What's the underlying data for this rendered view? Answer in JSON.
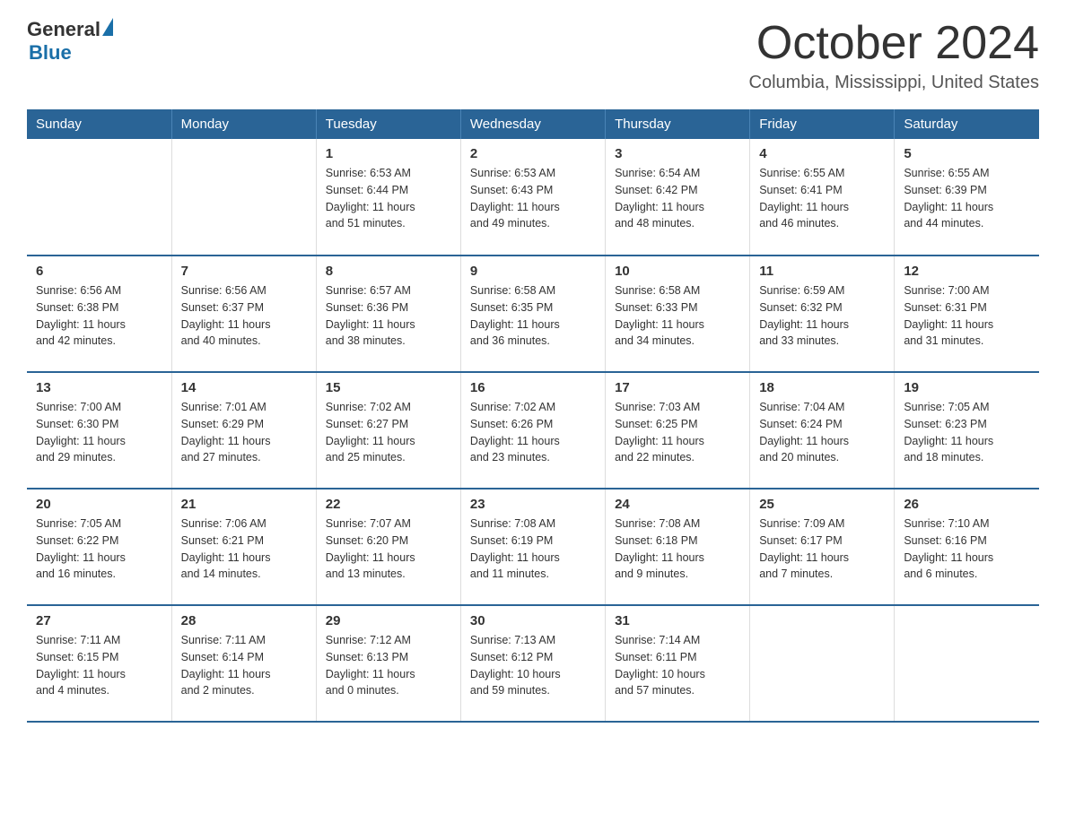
{
  "logo": {
    "general": "General",
    "triangle": "▲",
    "blue": "Blue"
  },
  "title": "October 2024",
  "subtitle": "Columbia, Mississippi, United States",
  "days_of_week": [
    "Sunday",
    "Monday",
    "Tuesday",
    "Wednesday",
    "Thursday",
    "Friday",
    "Saturday"
  ],
  "weeks": [
    [
      {
        "day": "",
        "info": ""
      },
      {
        "day": "",
        "info": ""
      },
      {
        "day": "1",
        "info": "Sunrise: 6:53 AM\nSunset: 6:44 PM\nDaylight: 11 hours\nand 51 minutes."
      },
      {
        "day": "2",
        "info": "Sunrise: 6:53 AM\nSunset: 6:43 PM\nDaylight: 11 hours\nand 49 minutes."
      },
      {
        "day": "3",
        "info": "Sunrise: 6:54 AM\nSunset: 6:42 PM\nDaylight: 11 hours\nand 48 minutes."
      },
      {
        "day": "4",
        "info": "Sunrise: 6:55 AM\nSunset: 6:41 PM\nDaylight: 11 hours\nand 46 minutes."
      },
      {
        "day": "5",
        "info": "Sunrise: 6:55 AM\nSunset: 6:39 PM\nDaylight: 11 hours\nand 44 minutes."
      }
    ],
    [
      {
        "day": "6",
        "info": "Sunrise: 6:56 AM\nSunset: 6:38 PM\nDaylight: 11 hours\nand 42 minutes."
      },
      {
        "day": "7",
        "info": "Sunrise: 6:56 AM\nSunset: 6:37 PM\nDaylight: 11 hours\nand 40 minutes."
      },
      {
        "day": "8",
        "info": "Sunrise: 6:57 AM\nSunset: 6:36 PM\nDaylight: 11 hours\nand 38 minutes."
      },
      {
        "day": "9",
        "info": "Sunrise: 6:58 AM\nSunset: 6:35 PM\nDaylight: 11 hours\nand 36 minutes."
      },
      {
        "day": "10",
        "info": "Sunrise: 6:58 AM\nSunset: 6:33 PM\nDaylight: 11 hours\nand 34 minutes."
      },
      {
        "day": "11",
        "info": "Sunrise: 6:59 AM\nSunset: 6:32 PM\nDaylight: 11 hours\nand 33 minutes."
      },
      {
        "day": "12",
        "info": "Sunrise: 7:00 AM\nSunset: 6:31 PM\nDaylight: 11 hours\nand 31 minutes."
      }
    ],
    [
      {
        "day": "13",
        "info": "Sunrise: 7:00 AM\nSunset: 6:30 PM\nDaylight: 11 hours\nand 29 minutes."
      },
      {
        "day": "14",
        "info": "Sunrise: 7:01 AM\nSunset: 6:29 PM\nDaylight: 11 hours\nand 27 minutes."
      },
      {
        "day": "15",
        "info": "Sunrise: 7:02 AM\nSunset: 6:27 PM\nDaylight: 11 hours\nand 25 minutes."
      },
      {
        "day": "16",
        "info": "Sunrise: 7:02 AM\nSunset: 6:26 PM\nDaylight: 11 hours\nand 23 minutes."
      },
      {
        "day": "17",
        "info": "Sunrise: 7:03 AM\nSunset: 6:25 PM\nDaylight: 11 hours\nand 22 minutes."
      },
      {
        "day": "18",
        "info": "Sunrise: 7:04 AM\nSunset: 6:24 PM\nDaylight: 11 hours\nand 20 minutes."
      },
      {
        "day": "19",
        "info": "Sunrise: 7:05 AM\nSunset: 6:23 PM\nDaylight: 11 hours\nand 18 minutes."
      }
    ],
    [
      {
        "day": "20",
        "info": "Sunrise: 7:05 AM\nSunset: 6:22 PM\nDaylight: 11 hours\nand 16 minutes."
      },
      {
        "day": "21",
        "info": "Sunrise: 7:06 AM\nSunset: 6:21 PM\nDaylight: 11 hours\nand 14 minutes."
      },
      {
        "day": "22",
        "info": "Sunrise: 7:07 AM\nSunset: 6:20 PM\nDaylight: 11 hours\nand 13 minutes."
      },
      {
        "day": "23",
        "info": "Sunrise: 7:08 AM\nSunset: 6:19 PM\nDaylight: 11 hours\nand 11 minutes."
      },
      {
        "day": "24",
        "info": "Sunrise: 7:08 AM\nSunset: 6:18 PM\nDaylight: 11 hours\nand 9 minutes."
      },
      {
        "day": "25",
        "info": "Sunrise: 7:09 AM\nSunset: 6:17 PM\nDaylight: 11 hours\nand 7 minutes."
      },
      {
        "day": "26",
        "info": "Sunrise: 7:10 AM\nSunset: 6:16 PM\nDaylight: 11 hours\nand 6 minutes."
      }
    ],
    [
      {
        "day": "27",
        "info": "Sunrise: 7:11 AM\nSunset: 6:15 PM\nDaylight: 11 hours\nand 4 minutes."
      },
      {
        "day": "28",
        "info": "Sunrise: 7:11 AM\nSunset: 6:14 PM\nDaylight: 11 hours\nand 2 minutes."
      },
      {
        "day": "29",
        "info": "Sunrise: 7:12 AM\nSunset: 6:13 PM\nDaylight: 11 hours\nand 0 minutes."
      },
      {
        "day": "30",
        "info": "Sunrise: 7:13 AM\nSunset: 6:12 PM\nDaylight: 10 hours\nand 59 minutes."
      },
      {
        "day": "31",
        "info": "Sunrise: 7:14 AM\nSunset: 6:11 PM\nDaylight: 10 hours\nand 57 minutes."
      },
      {
        "day": "",
        "info": ""
      },
      {
        "day": "",
        "info": ""
      }
    ]
  ]
}
